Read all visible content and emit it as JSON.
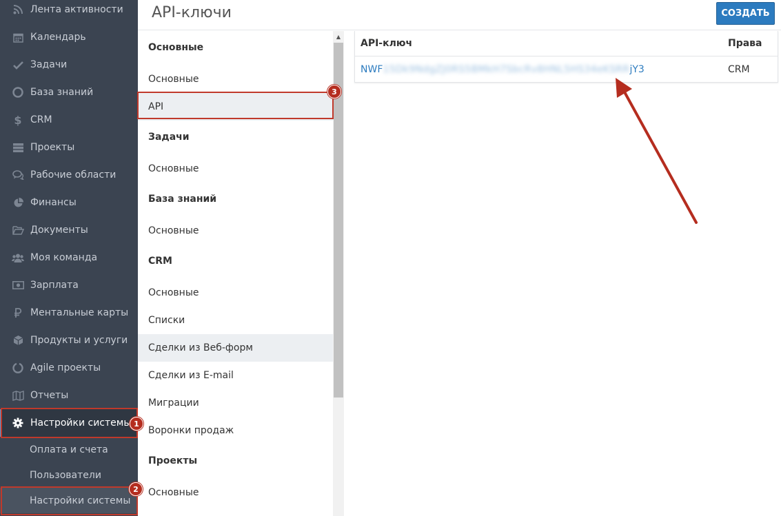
{
  "sidebar": {
    "items": [
      {
        "label": "Лента активности",
        "icon": "rss-icon"
      },
      {
        "label": "Календарь",
        "icon": "calendar-icon"
      },
      {
        "label": "Задачи",
        "icon": "check-icon"
      },
      {
        "label": "База знаний",
        "icon": "lifebuoy-icon"
      },
      {
        "label": "CRM",
        "icon": "dollar-icon"
      },
      {
        "label": "Проекты",
        "icon": "server-icon"
      },
      {
        "label": "Рабочие области",
        "icon": "comments-icon"
      },
      {
        "label": "Финансы",
        "icon": "pie-chart-icon"
      },
      {
        "label": "Документы",
        "icon": "folder-open-icon"
      },
      {
        "label": "Моя команда",
        "icon": "users-icon"
      },
      {
        "label": "Зарплата",
        "icon": "money-icon"
      },
      {
        "label": "Ментальные карты",
        "icon": "ruble-icon"
      },
      {
        "label": "Продукты и услуги",
        "icon": "cube-icon"
      },
      {
        "label": "Agile проекты",
        "icon": "circle-notch-icon"
      },
      {
        "label": "Отчеты",
        "icon": "map-icon"
      },
      {
        "label": "Настройки системы",
        "icon": "gear-icon"
      }
    ],
    "subitems": [
      {
        "label": "Оплата и счета"
      },
      {
        "label": "Пользователи"
      },
      {
        "label": "Настройки системы"
      }
    ]
  },
  "header": {
    "title": "API-ключи",
    "create_label": "Создать"
  },
  "settings_menu": {
    "groups": [
      {
        "title": "Основные",
        "items": [
          "Основные",
          "API"
        ]
      },
      {
        "title": "Задачи",
        "items": [
          "Основные"
        ]
      },
      {
        "title": "База знаний",
        "items": [
          "Основные"
        ]
      },
      {
        "title": "CRM",
        "items": [
          "Основные",
          "Списки",
          "Сделки из Веб-форм",
          "Сделки из E-mail",
          "Миграции",
          "Воронки продаж"
        ]
      },
      {
        "title": "Проекты",
        "items": [
          "Основные"
        ]
      }
    ]
  },
  "keys_table": {
    "headers": {
      "key": "API-ключ",
      "rights": "Права"
    },
    "rows": [
      {
        "key_start": "NWF",
        "key_hidden": "15Dk9NdgZJ0RS5BMkH7SbcRv8HNL5HS34eKSRR",
        "key_end": "jY3",
        "rights": "CRM"
      }
    ]
  },
  "annotations": {
    "marker1": "1",
    "marker2": "2",
    "marker3": "3"
  },
  "colors": {
    "sidebar_bg": "#3b4451",
    "accent": "#2c7bbf",
    "annotation": "#c0392b"
  }
}
